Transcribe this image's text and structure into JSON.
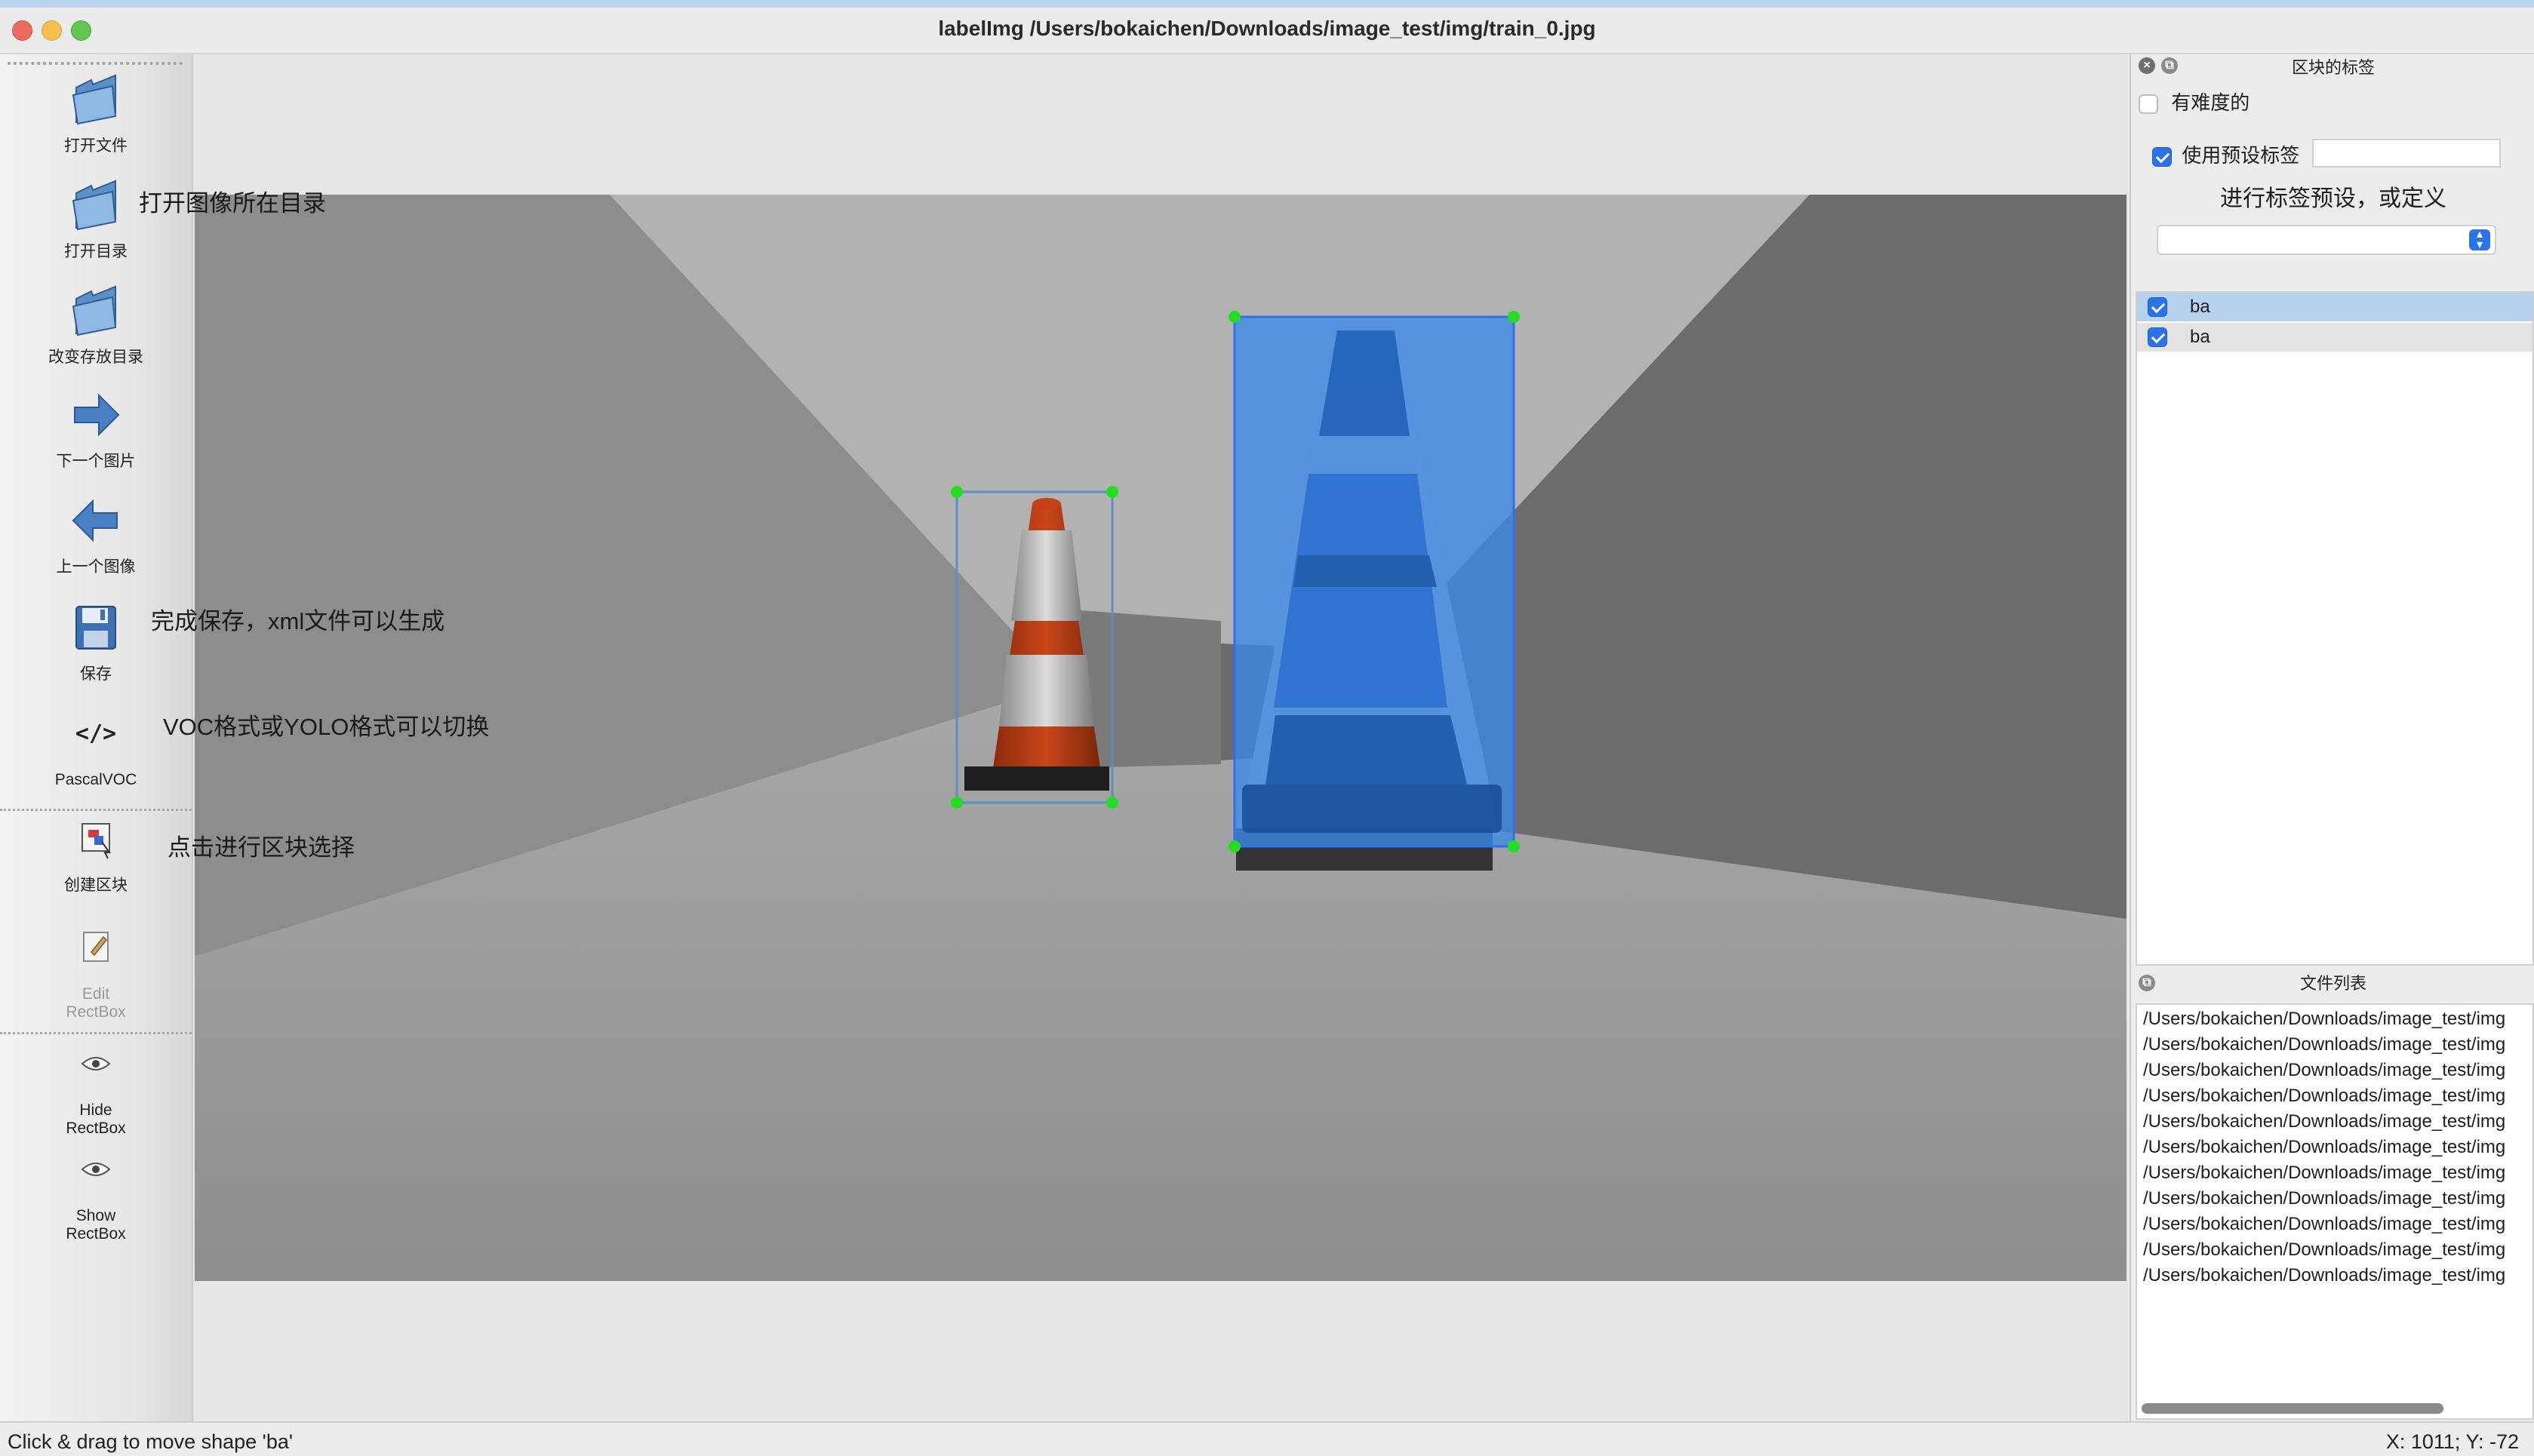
{
  "window": {
    "title": "labelImg /Users/bokaichen/Downloads/image_test/img/train_0.jpg"
  },
  "toolbar": {
    "items": [
      {
        "label": "打开文件",
        "icon": "folder-icon"
      },
      {
        "label": "打开目录",
        "icon": "folder-icon"
      },
      {
        "label": "改变存放目录",
        "icon": "folder-icon"
      },
      {
        "label": "下一个图片",
        "icon": "arrow-right-icon"
      },
      {
        "label": "上一个图像",
        "icon": "arrow-left-icon"
      },
      {
        "label": "保存",
        "icon": "floppy-disk-icon"
      },
      {
        "label": "PascalVOC",
        "icon": "code-brackets-icon"
      },
      {
        "label": "创建区块",
        "icon": "create-rectbox-icon"
      },
      {
        "label": "Edit\nRectBox",
        "icon": "edit-rectbox-icon"
      },
      {
        "label": "Hide\nRectBox",
        "icon": "eye-icon"
      },
      {
        "label": "Show\nRectBox",
        "icon": "eye-icon"
      }
    ]
  },
  "annotations": {
    "open_dir": "打开图像所在目录",
    "save": "完成保存，xml文件可以生成",
    "format": "VOC格式或YOLO格式可以切换",
    "create": "点击进行区块选择"
  },
  "dock_labels": {
    "title": "区块的标签",
    "difficult_label": "有难度的",
    "use_default_label": "使用预设标签",
    "default_label_value": "",
    "preset_hint": "进行标签预设，或定义",
    "combo_value": "",
    "labels": [
      "ba",
      "ba"
    ]
  },
  "dock_files": {
    "title": "文件列表",
    "files": [
      "/Users/bokaichen/Downloads/image_test/img",
      "/Users/bokaichen/Downloads/image_test/img",
      "/Users/bokaichen/Downloads/image_test/img",
      "/Users/bokaichen/Downloads/image_test/img",
      "/Users/bokaichen/Downloads/image_test/img",
      "/Users/bokaichen/Downloads/image_test/img",
      "/Users/bokaichen/Downloads/image_test/img",
      "/Users/bokaichen/Downloads/image_test/img",
      "/Users/bokaichen/Downloads/image_test/img",
      "/Users/bokaichen/Downloads/image_test/img",
      "/Users/bokaichen/Downloads/image_test/img"
    ]
  },
  "status": {
    "message": "Click & drag to move shape 'ba'",
    "coords": "X: 1011; Y: -72"
  },
  "colors": {
    "accent": "#2a73e8",
    "selected_box_fill": "#3a8be8",
    "handle": "#22dd22"
  }
}
